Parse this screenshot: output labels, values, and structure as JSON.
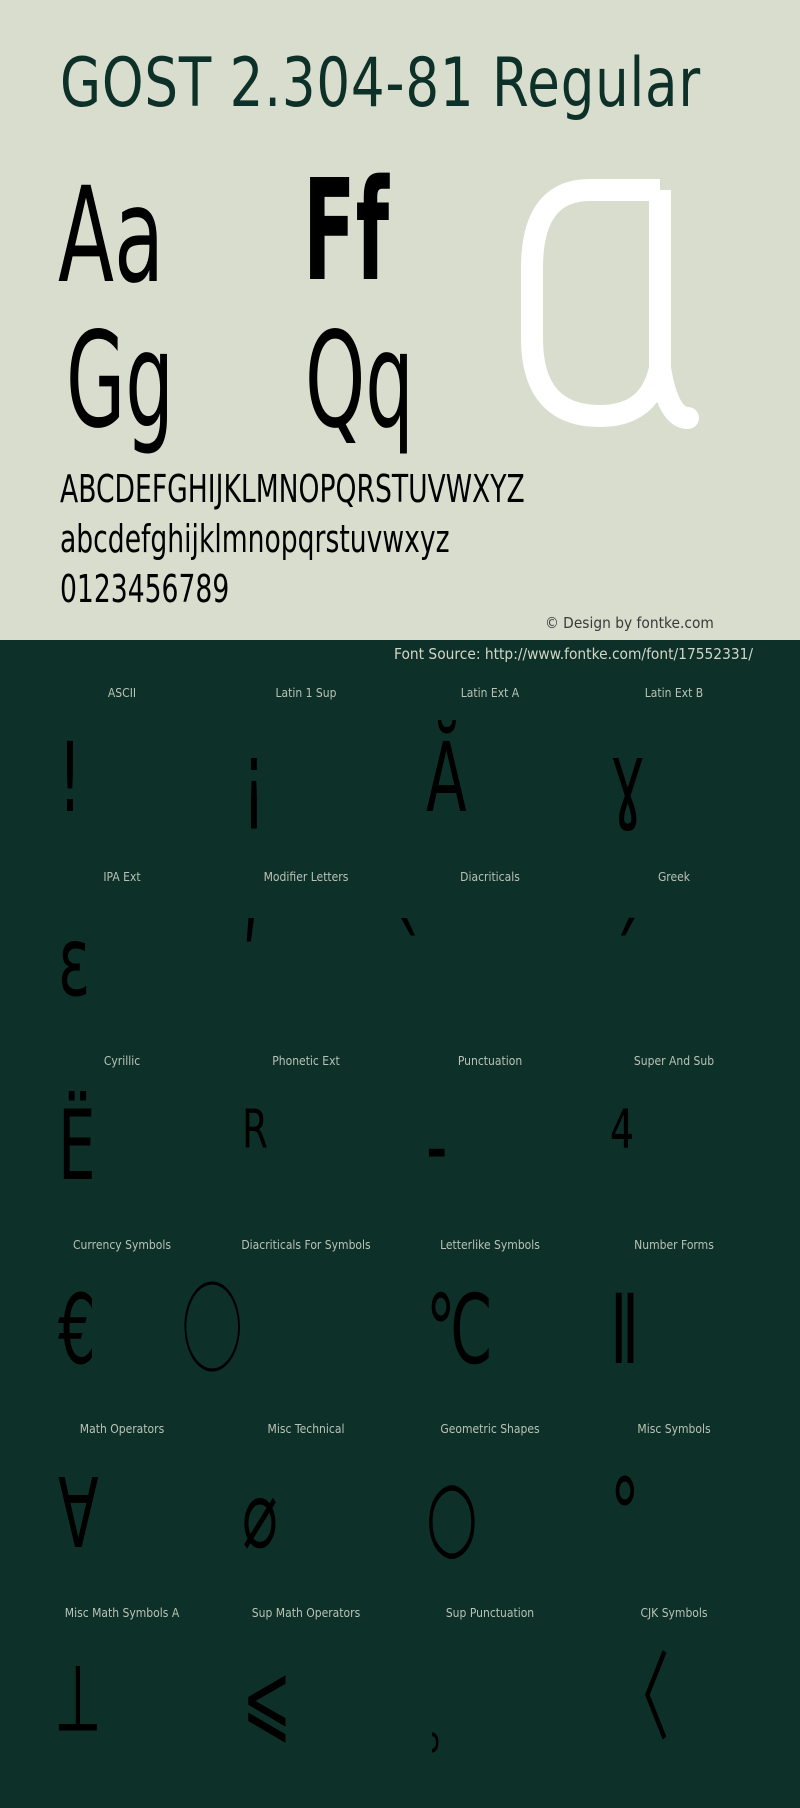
{
  "header": {
    "title": "GOST 2.304-81 Regular"
  },
  "samples": {
    "pair1": "Aa",
    "pair2": "Ff",
    "pair3": "Gg",
    "pair4": "Qq",
    "featured_glyph": "a"
  },
  "charset": {
    "uppercase": "ABCDEFGHIJKLMNOPQRSTUVWXYZ",
    "lowercase": "abcdefghijklmnopqrstuvwxyz",
    "digits": "0123456789"
  },
  "credit": "© Design by fontke.com",
  "source": "Font Source: http://www.fontke.com/font/17552331/",
  "colors": {
    "top_background": "#d9ddcd",
    "bottom_background": "#0d3028",
    "title_color": "#0d3028",
    "featured_glyph_color": "#ffffff"
  },
  "blocks": [
    {
      "label": "ASCII",
      "glyph": "!"
    },
    {
      "label": "Latin 1 Sup",
      "glyph": "¡"
    },
    {
      "label": "Latin Ext A",
      "glyph": "Ă"
    },
    {
      "label": "Latin Ext B",
      "glyph": "ɣ"
    },
    {
      "label": "IPA Ext",
      "glyph": "ɛ"
    },
    {
      "label": "Modifier Letters",
      "glyph": "ʹ"
    },
    {
      "label": "Diacriticals",
      "glyph": "̀"
    },
    {
      "label": "Greek",
      "glyph": "΄"
    },
    {
      "label": "Cyrillic",
      "glyph": "Ё"
    },
    {
      "label": "Phonetic Ext",
      "glyph": "ᴿ"
    },
    {
      "label": "Punctuation",
      "glyph": "‐"
    },
    {
      "label": "Super And Sub",
      "glyph": "⁴"
    },
    {
      "label": "Currency Symbols",
      "glyph": "€"
    },
    {
      "label": "Diacriticals For Symbols",
      "glyph": "⃝"
    },
    {
      "label": "Letterlike Symbols",
      "glyph": "℃"
    },
    {
      "label": "Number Forms",
      "glyph": "Ⅱ"
    },
    {
      "label": "Math Operators",
      "glyph": "∀"
    },
    {
      "label": "Misc Technical",
      "glyph": "⌀"
    },
    {
      "label": "Geometric Shapes",
      "glyph": "○"
    },
    {
      "label": "Misc Symbols",
      "glyph": "°"
    },
    {
      "label": "Misc Math Symbols A",
      "glyph": "⟂"
    },
    {
      "label": "Sup Math Operators",
      "glyph": "⩽"
    },
    {
      "label": "Sup Punctuation",
      "glyph": "⸒"
    },
    {
      "label": "CJK Symbols",
      "glyph": "〈"
    }
  ]
}
